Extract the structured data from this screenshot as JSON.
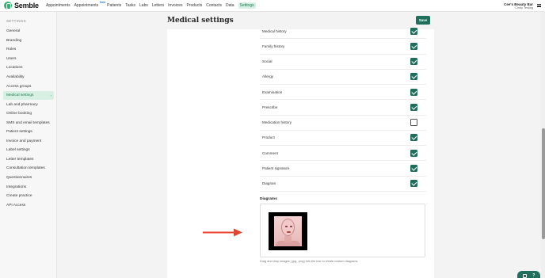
{
  "app": {
    "name": "Semble"
  },
  "nav": {
    "items": [
      "Appointments",
      "Appointments",
      "Patients",
      "Tasks",
      "Labs",
      "Letters",
      "Invoices",
      "Products",
      "Contacts",
      "Data",
      "Settings"
    ],
    "new_badge": "New",
    "active": "Settings"
  },
  "account": {
    "org": "Cee's Beauty Bar",
    "user": "Cindy Testing"
  },
  "sidebar": {
    "title": "SETTINGS",
    "items": [
      "General",
      "Branding",
      "Roles",
      "Users",
      "Locations",
      "Availability",
      "Access groups",
      "Medical settings",
      "Lab and pharmacy",
      "Online booking",
      "SMS and email templates",
      "Patient settings",
      "Invoice and payment",
      "Label settings",
      "Letter templates",
      "Consultation templates",
      "Questionnaires",
      "Integrations",
      "Create practice",
      "API Access"
    ],
    "active_index": 7,
    "active_chevron": "›"
  },
  "page": {
    "title": "Medical settings",
    "save_label": "Save"
  },
  "settings_rows": [
    {
      "label": "Medical history",
      "checked": true
    },
    {
      "label": "Family history",
      "checked": true
    },
    {
      "label": "Social",
      "checked": true
    },
    {
      "label": "Allergy",
      "checked": true
    },
    {
      "label": "Examination",
      "checked": true
    },
    {
      "label": "Prescribe",
      "checked": true
    },
    {
      "label": "Medication history",
      "checked": false
    },
    {
      "label": "Product",
      "checked": true
    },
    {
      "label": "Comment",
      "checked": true
    },
    {
      "label": "Patient signature",
      "checked": true
    },
    {
      "label": "Diagram",
      "checked": true
    }
  ],
  "diagrams": {
    "title": "Diagrams",
    "hint": "Drag and drop images (.jpg, .png) into the box to create custom diagrams."
  },
  "colors": {
    "brand": "#2bb673",
    "primary": "#1f6f5c",
    "active_bg": "#d8f0e4",
    "arrow": "#e8412c"
  },
  "help_widget": {
    "label": "?"
  }
}
